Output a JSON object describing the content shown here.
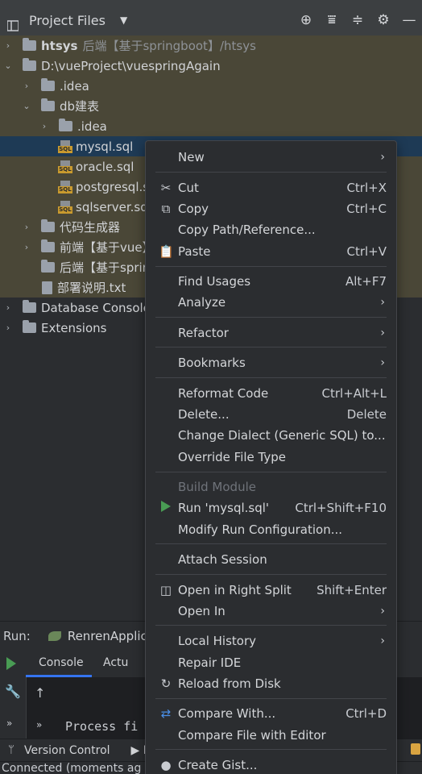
{
  "header": {
    "title": "Project Files",
    "tools": [
      "crosshair-icon",
      "expand-all-icon",
      "collapse-all-icon",
      "gear-icon",
      "minimize-icon"
    ]
  },
  "tree": {
    "items": [
      {
        "label": "htsys",
        "sub": "后端【基于springboot】/htsys"
      },
      {
        "label": "D:\\vueProject\\vuespringAgain"
      },
      {
        "label": ".idea"
      },
      {
        "label": "db建表"
      },
      {
        "label": ".idea"
      },
      {
        "label": "mysql.sql"
      },
      {
        "label": "oracle.sql"
      },
      {
        "label": "postgresql.s"
      },
      {
        "label": "sqlserver.sq"
      },
      {
        "label": "代码生成器"
      },
      {
        "label": "前端【基于vue】"
      },
      {
        "label": "后端【基于sprin"
      },
      {
        "label": "部署说明.txt"
      },
      {
        "label": "Database Console"
      },
      {
        "label": "Extensions"
      }
    ]
  },
  "run": {
    "label": "Run:",
    "app": "RenrenApplic",
    "tabs": {
      "console": "Console",
      "actuator": "Actu"
    },
    "console_text": "Process fi"
  },
  "bottom": {
    "version_control": "Version Control",
    "run_tab": "R",
    "status": "Connected (moments ag"
  },
  "menu": {
    "items": [
      {
        "label": "New"
      },
      {
        "label": "Cut",
        "shortcut": "Ctrl+X"
      },
      {
        "label": "Copy",
        "shortcut": "Ctrl+C"
      },
      {
        "label": "Copy Path/Reference..."
      },
      {
        "label": "Paste",
        "shortcut": "Ctrl+V"
      },
      {
        "label": "Find Usages",
        "shortcut": "Alt+F7"
      },
      {
        "label": "Analyze"
      },
      {
        "label": "Refactor"
      },
      {
        "label": "Bookmarks"
      },
      {
        "label": "Reformat Code",
        "shortcut": "Ctrl+Alt+L"
      },
      {
        "label": "Delete...",
        "shortcut": "Delete"
      },
      {
        "label": "Change Dialect (Generic SQL) to..."
      },
      {
        "label": "Override File Type"
      },
      {
        "label": "Build Module"
      },
      {
        "label": "Run 'mysql.sql'",
        "shortcut": "Ctrl+Shift+F10"
      },
      {
        "label": "Modify Run Configuration..."
      },
      {
        "label": "Attach Session"
      },
      {
        "label": "Open in Right Split",
        "shortcut": "Shift+Enter"
      },
      {
        "label": "Open In"
      },
      {
        "label": "Local History"
      },
      {
        "label": "Repair IDE"
      },
      {
        "label": "Reload from Disk"
      },
      {
        "label": "Compare With...",
        "shortcut": "Ctrl+D"
      },
      {
        "label": "Compare File with Editor"
      },
      {
        "label": "Create Gist..."
      }
    ]
  }
}
